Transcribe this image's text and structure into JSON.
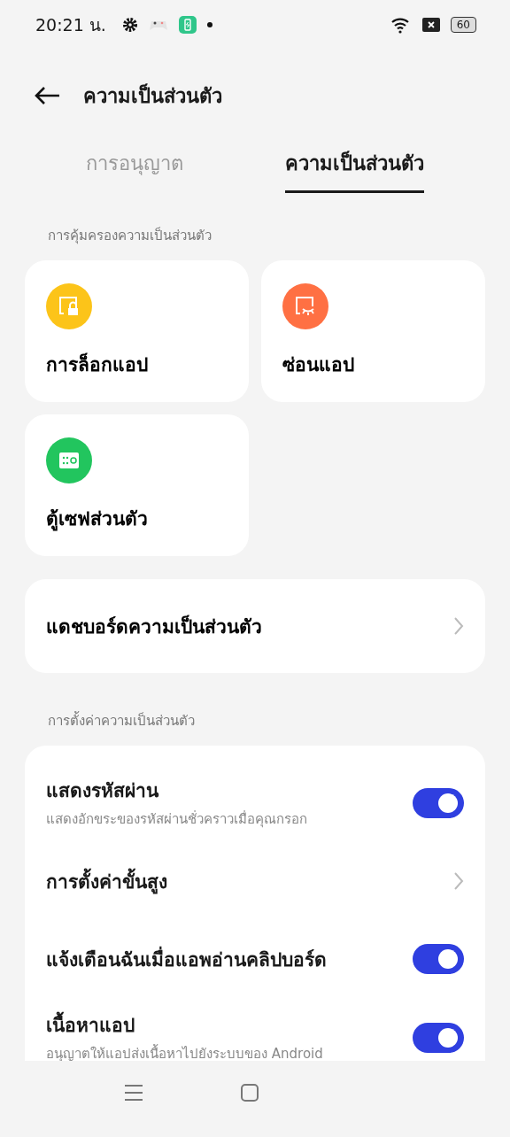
{
  "status_bar": {
    "time": "20:21 น.",
    "battery": "60"
  },
  "header": {
    "title": "ความเป็นส่วนตัว"
  },
  "tabs": [
    {
      "label": "การอนุญาต",
      "selected": false
    },
    {
      "label": "ความเป็นส่วนตัว",
      "selected": true
    }
  ],
  "protection": {
    "heading": "การคุ้มครองความเป็นส่วนตัว",
    "tiles": [
      {
        "label": "การล็อกแอป",
        "kind": "lock",
        "color": "#fcc419"
      },
      {
        "label": "ซ่อนแอป",
        "kind": "hide",
        "color": "#ff7043"
      },
      {
        "label": "ตู้เซฟส่วนตัว",
        "kind": "safe",
        "color": "#22c55e"
      }
    ]
  },
  "dashboard": {
    "label": "แดชบอร์ดความเป็นส่วนตัว"
  },
  "settings": {
    "heading": "การตั้งค่าความเป็นส่วนตัว",
    "items": [
      {
        "kind": "toggle",
        "title": "แสดงรหัสผ่าน",
        "subtitle": "แสดงอักขระของรหัสผ่านชั่วคราวเมื่อคุณกรอก",
        "on": true
      },
      {
        "kind": "link",
        "title": "การตั้งค่าขั้นสูง"
      },
      {
        "kind": "toggle",
        "title": "แจ้งเตือนฉันเมื่อแอพอ่านคลิปบอร์ด",
        "on": true
      },
      {
        "kind": "toggle",
        "title": "เนื้อหาแอป",
        "subtitle": "อนุญาตให้แอปส่งเนื้อหาไปยังระบบของ Android",
        "on": true
      }
    ]
  }
}
